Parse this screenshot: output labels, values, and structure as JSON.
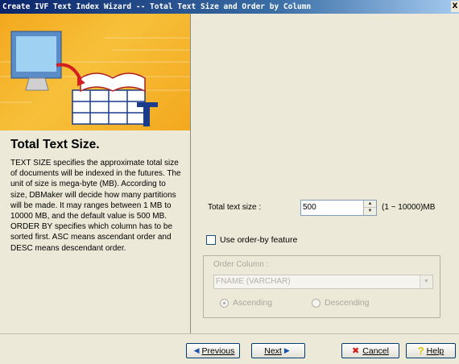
{
  "window": {
    "title": "Create IVF Text Index Wizard -- Total Text Size and Order by Column",
    "close_glyph": "X"
  },
  "help": {
    "title": "Total Text Size.",
    "text": "TEXT SIZE specifies the approximate total size of documents will be indexed in the futures. The unit of size is mega-byte (MB). According to size, DBMaker will decide how many partitions will be made. It may ranges between 1 MB to 10000 MB, and the default value is 500 MB. ORDER BY specifies which column has to be sorted first. ASC means ascendant order and DESC means descendant order."
  },
  "form": {
    "text_size_label": "Total text size :",
    "text_size_value": "500",
    "text_size_range": "(1 ~ 10000)MB",
    "use_orderby_label": "Use order-by feature",
    "use_orderby_checked": false,
    "order_column_group_label": "Order Column :",
    "order_column_value": "FNAME (VARCHAR)",
    "ascending_label": "Ascending",
    "descending_label": "Descending",
    "selected_order": "Ascending"
  },
  "buttons": {
    "previous": "Previous",
    "next": "Next",
    "cancel": "Cancel",
    "help": "Help"
  },
  "colors": {
    "banner_orange": "#f3a81e",
    "title_blue": "#0a246a",
    "disabled_text": "#a9a79d"
  }
}
